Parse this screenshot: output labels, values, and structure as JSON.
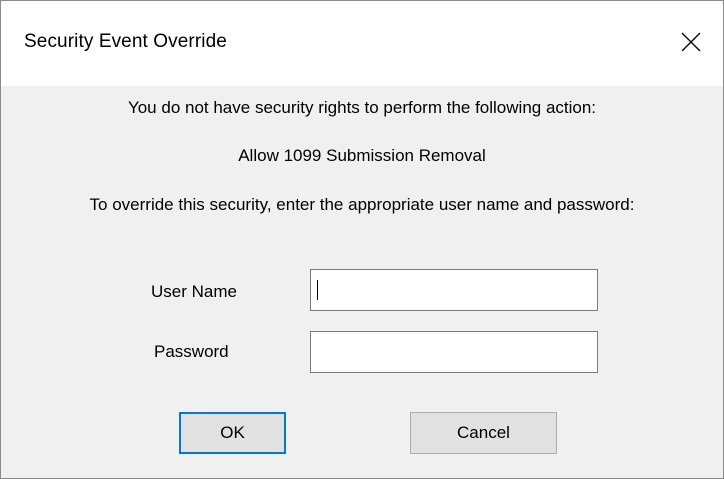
{
  "window": {
    "title": "Security Event Override",
    "close_icon": "close-x-icon"
  },
  "message": {
    "line1": "You do not have security rights to perform the following action:",
    "action": "Allow 1099 Submission Removal",
    "line3": "To override this security, enter the appropriate user name and password:"
  },
  "form": {
    "user_name_label": "User Name",
    "user_name_value": "",
    "password_label": "Password",
    "password_value": ""
  },
  "buttons": {
    "ok_label": "OK",
    "cancel_label": "Cancel"
  },
  "colors": {
    "titlebar_bg": "#ffffff",
    "client_bg": "#f0f0f0",
    "default_button_border": "#0078d7"
  }
}
